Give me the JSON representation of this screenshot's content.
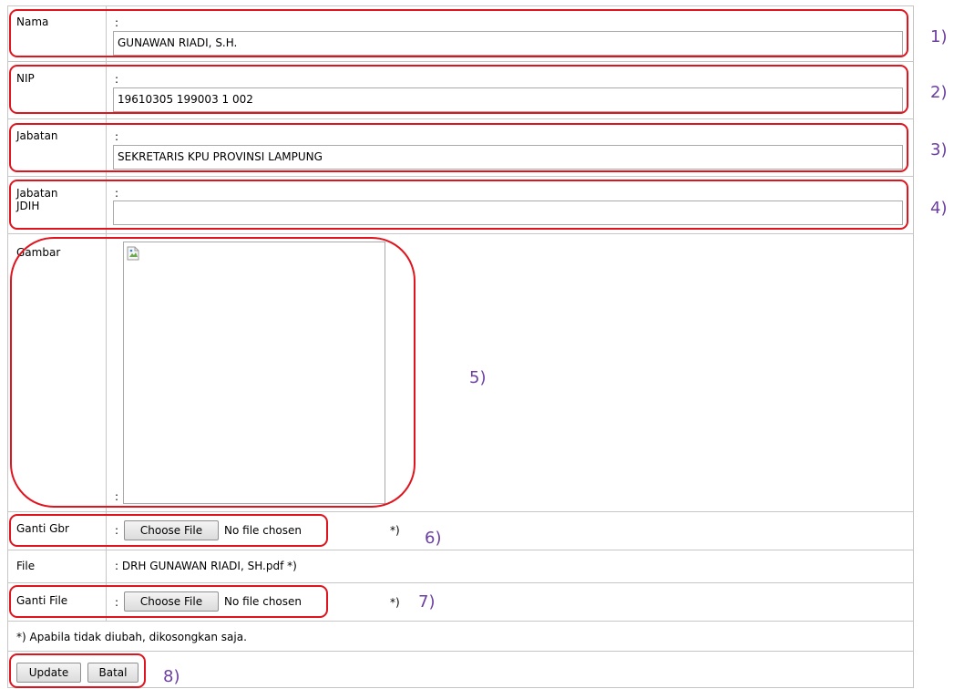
{
  "form": {
    "nama": {
      "label": "Nama",
      "value": "GUNAWAN RIADI, S.H."
    },
    "nip": {
      "label": "NIP",
      "value": "19610305 199003 1 002"
    },
    "jabatan": {
      "label": "Jabatan",
      "value": "SEKRETARIS KPU PROVINSI LAMPUNG"
    },
    "jabatan_jdih": {
      "label_line1": "Jabatan",
      "label_line2": "JDIH",
      "value": ""
    },
    "gambar": {
      "label": "Gambar"
    },
    "ganti_gbr": {
      "label": "Ganti Gbr",
      "button": "Choose File",
      "status": "No file chosen",
      "note": "*)"
    },
    "file": {
      "label": "File",
      "value": ": DRH GUNAWAN RIADI, SH.pdf *)"
    },
    "ganti_file": {
      "label": "Ganti File",
      "button": "Choose File",
      "status": "No file chosen",
      "note": "*)"
    },
    "footnote": "*) Apabila tidak diubah, dikosongkan saja.",
    "buttons": {
      "update": "Update",
      "batal": "Batal"
    },
    "colon": ":",
    "field_mark": "_"
  },
  "annotations": [
    "1)",
    "2)",
    "3)",
    "4)",
    "5)",
    "6)",
    "7)",
    "8)"
  ],
  "colors": {
    "annotation_box": "#e0141e",
    "annotation_number": "#6b3fa0",
    "grid": "#c6c6c6"
  }
}
